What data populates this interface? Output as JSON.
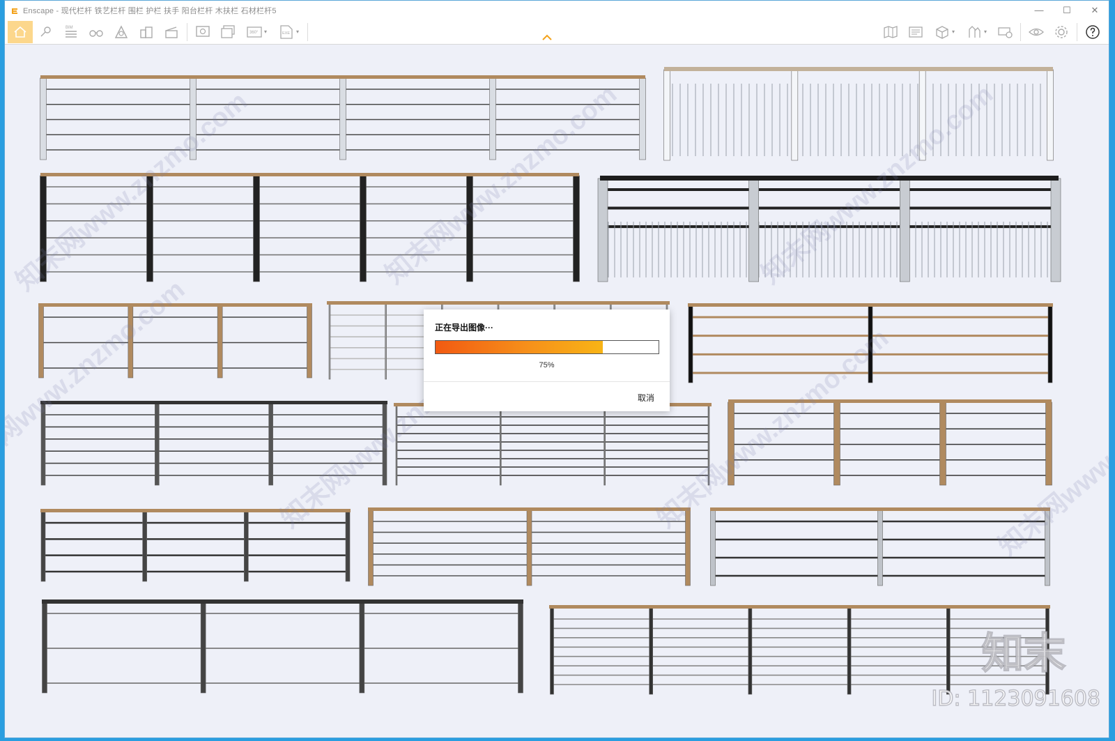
{
  "window": {
    "title": "Enscape - 现代栏杆 铁艺栏杆 围栏 护栏 扶手 阳台栏杆 木扶栏 石材栏杆5",
    "controls": {
      "minimize": "—",
      "maximize": "☐",
      "close": "✕"
    }
  },
  "toolbar": {
    "left_buttons": [
      {
        "name": "home-icon",
        "label": ""
      },
      {
        "name": "location-icon",
        "label": ""
      },
      {
        "name": "bim-icon",
        "label": "BIM"
      },
      {
        "name": "binoculars-icon",
        "label": ""
      },
      {
        "name": "atmosphere-icon",
        "label": ""
      },
      {
        "name": "buildings-icon",
        "label": ""
      },
      {
        "name": "clapper-icon",
        "label": ""
      }
    ],
    "export_buttons": [
      {
        "name": "screenshot-icon",
        "label": ""
      },
      {
        "name": "batch-render-icon",
        "label": ""
      },
      {
        "name": "panorama-icon",
        "label": "360°"
      },
      {
        "name": "export-exe-icon",
        "label": "EXE"
      }
    ],
    "right_buttons": [
      {
        "name": "map-icon"
      },
      {
        "name": "asset-library-icon"
      },
      {
        "name": "box-icon"
      },
      {
        "name": "materials-icon"
      },
      {
        "name": "collaboration-icon"
      },
      {
        "name": "eye-icon"
      },
      {
        "name": "settings-icon"
      },
      {
        "name": "help-icon"
      }
    ]
  },
  "dialog": {
    "message": "正在导出图像···",
    "progress": 0.75,
    "progress_label": "75%",
    "cancel_label": "取消"
  },
  "watermark": {
    "repeat_text": "知末网www.znzmo.com",
    "brand": "知末",
    "id_text": "ID: 1123091608"
  },
  "colors": {
    "handrail_wood": "#b08a5f",
    "steel": "#3c3c40",
    "viewport_bg": "#eef0f8",
    "home_highlight": "#fcd78c",
    "progress_start": "#f25a12",
    "progress_end": "#f8b416"
  }
}
